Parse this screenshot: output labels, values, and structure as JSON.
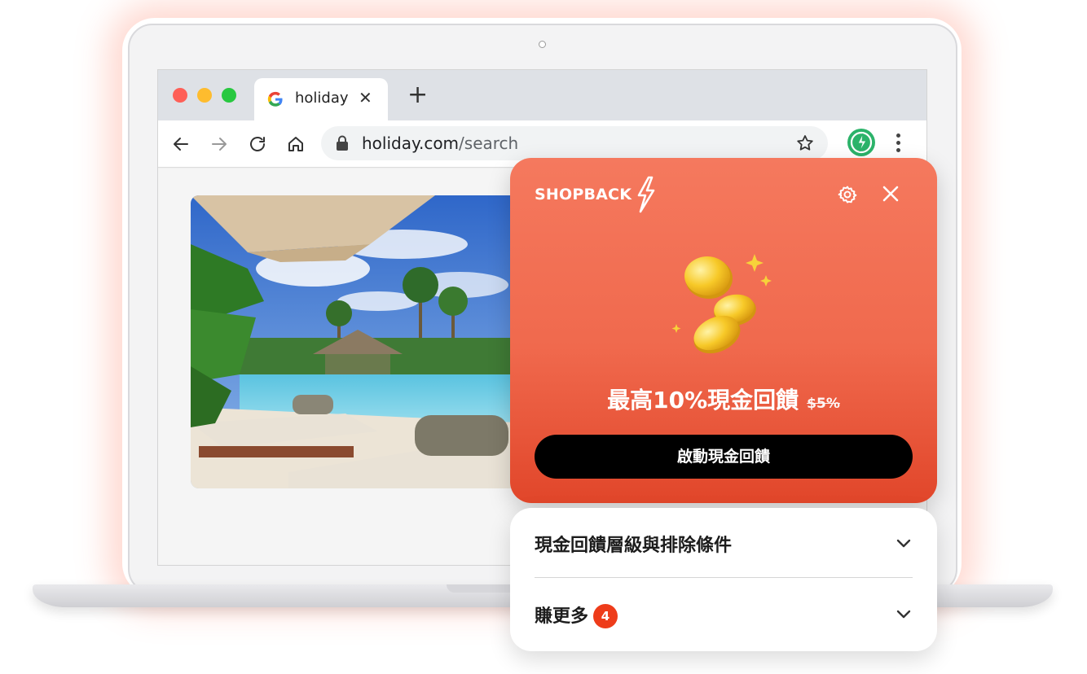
{
  "browser": {
    "tab_title": "holiday",
    "new_tab_symbol": "+",
    "tab_close_symbol": "✕",
    "url_domain": "holiday.com",
    "url_path": "/search"
  },
  "popup": {
    "brand": "SHOPBACK",
    "headline": "最高10%現金回饋",
    "old_rate": "$5%",
    "cta_label": "啟動現金回饋",
    "accent_color": "#f0694d"
  },
  "accordion": {
    "items": [
      {
        "label": "現金回饋層級與排除條件"
      },
      {
        "label": "賺更多",
        "badge": "4"
      }
    ]
  },
  "icons": {
    "back": "arrow-left-icon",
    "forward": "arrow-right-icon",
    "reload": "reload-icon",
    "home": "home-icon",
    "lock": "lock-icon",
    "bookmark": "star-icon",
    "extension": "shopback-extension-icon",
    "menu": "kebab-menu-icon",
    "settings": "gear-icon",
    "close": "close-icon",
    "expand": "chevron-down-icon"
  }
}
